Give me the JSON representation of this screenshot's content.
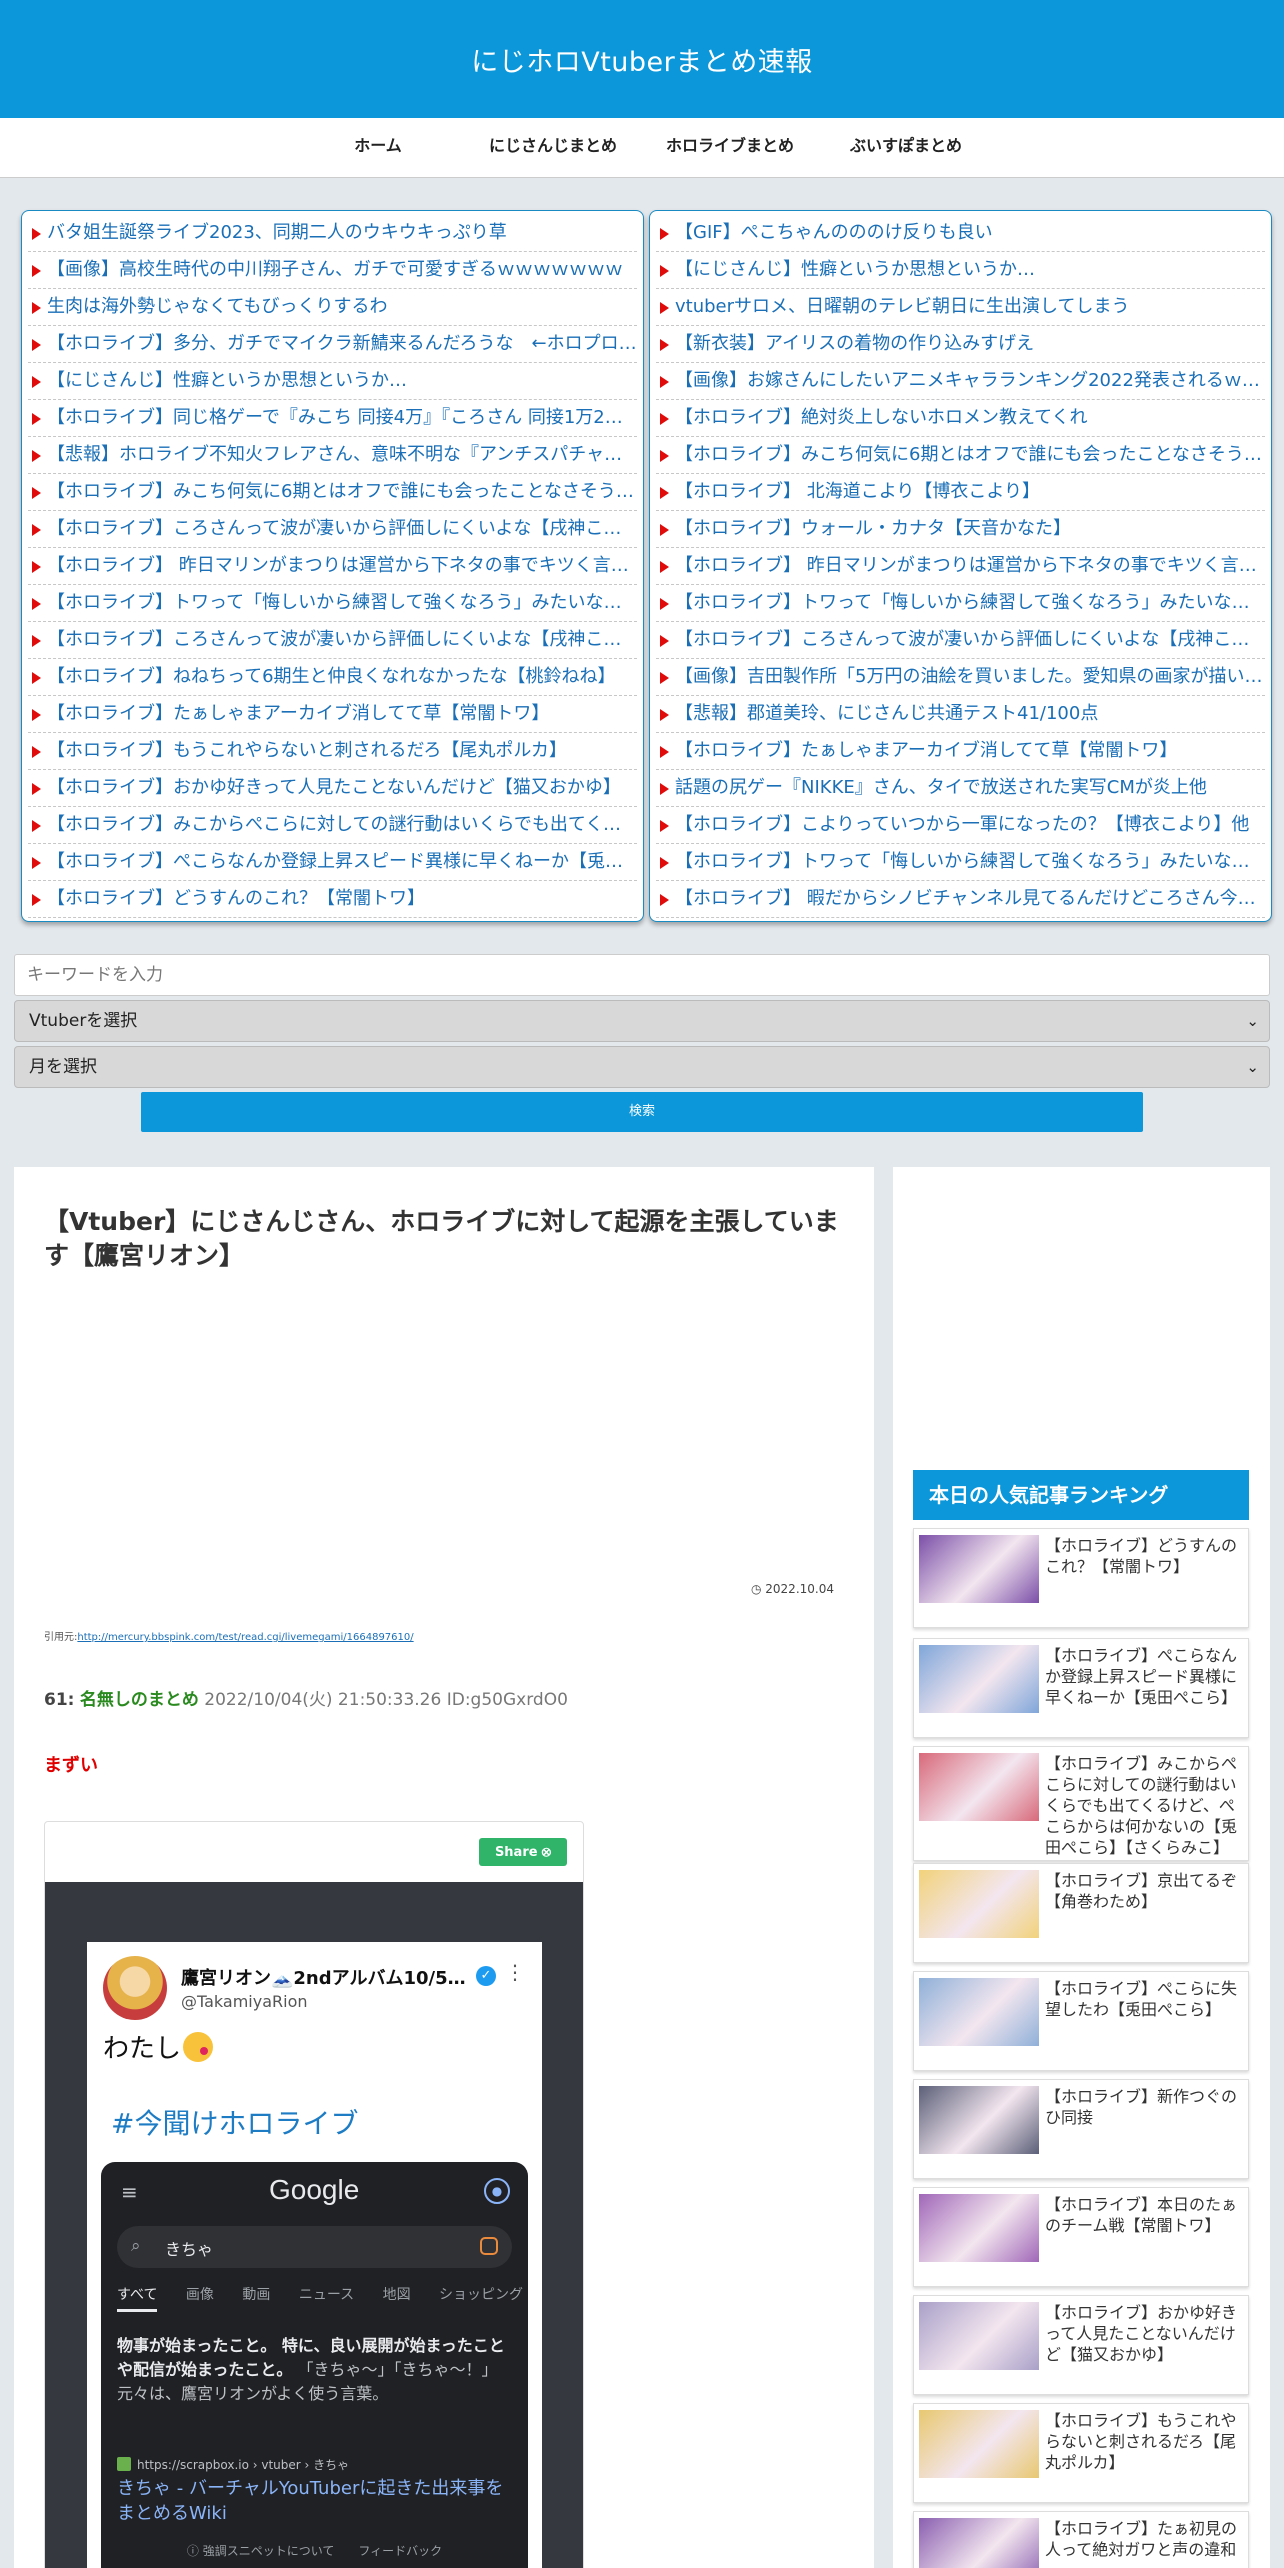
{
  "site": {
    "title": "にじホロVtuberまとめ速報"
  },
  "nav": [
    "ホーム",
    "にじさんじまとめ",
    "ホロライブまとめ",
    "ぶいすぽまとめ"
  ],
  "links_left": [
    "バタ姐生誕祭ライブ2023、同期二人のウキウキっぷり草",
    "【画像】高校生時代の中川翔子さん、ガチで可愛すぎるｗｗｗｗｗｗｗ",
    "生肉は海外勢じゃなくてもびっくりするわ",
    "【ホロライブ】多分、ガチでマイクラ新鯖来るんだろうな　←ホロプロ…",
    "【にじさんじ】性癖というか思想というか…",
    "【ホロライブ】同じ格ゲーで『みこち 同接4万』『ころさん 同接1万2…",
    "【悲報】ホロライブ不知火フレアさん、意味不明な『アンチスパチャ』…",
    "【ホロライブ】みこち何気に6期とはオフで誰にも会ったことなさそう…",
    "【ホロライブ】ころさんって波が凄いから評価しにくいよな【戌神ころ…",
    "【ホロライブ】 昨日マリンがまつりは運営から下ネタの事でキツく言…",
    "【ホロライブ】トワって「悔しいから練習して強くなろう」みたいな感…",
    "【ホロライブ】ころさんって波が凄いから評価しにくいよな【戌神ころ…",
    "【ホロライブ】ねねちって6期生と仲良くなれなかったな【桃鈴ねね】",
    "【ホロライブ】たぁしゃまアーカイブ消してて草【常闇トワ】",
    "【ホロライブ】もうこれやらないと刺されるだろ【尾丸ポルカ】",
    "【ホロライブ】おかゆ好きって人見たことないんだけど【猫又おかゆ】",
    "【ホロライブ】みこからぺこらに対しての謎行動はいくらでも出てくる…",
    "【ホロライブ】ぺこらなんか登録上昇スピード異様に早くねーか【兎田…",
    "【ホロライブ】どうすんのこれ？【常闇トワ】"
  ],
  "links_right": [
    "【GIF】ぺこちゃんのののけ反りも良い",
    "【にじさんじ】性癖というか思想というか…",
    "vtuberサロメ、日曜朝のテレビ朝日に生出演してしまう",
    "【新衣装】アイリスの着物の作り込みすげえ",
    "【画像】お嫁さんにしたいアニメキャラランキング2022発表されるｗ…",
    "【ホロライブ】絶対炎上しないホロメン教えてくれ",
    "【ホロライブ】みこち何気に6期とはオフで誰にも会ったことなさそう…",
    "【ホロライブ】 北海道こより【博衣こより】",
    "【ホロライブ】ウォール・カナタ【天音かなた】",
    "【ホロライブ】 昨日マリンがまつりは運営から下ネタの事でキツく言…",
    "【ホロライブ】トワって「悔しいから練習して強くなろう」みたいな感…",
    "【ホロライブ】ころさんって波が凄いから評価しにくいよな【戌神ころ…",
    "【画像】吉田製作所「5万円の油絵を買いました。愛知県の画家が描い…",
    "【悲報】郡道美玲、にじさんじ共通テスト41/100点",
    "【ホロライブ】たぁしゃまアーカイブ消してて草【常闇トワ】",
    "話題の尻ゲー『NIKKE』さん、タイで放送された実写CMが炎上他",
    "【ホロライブ】こよりっていつから一軍になったの？【博衣こより】他",
    "【ホロライブ】トワって「悔しいから練習して強くなろう」みたいな感…",
    "【ホロライブ】 暇だからシノビチャンネル見てるんだけどころさん今…"
  ],
  "search": {
    "placeholder": "キーワードを入力",
    "vtuber_select": "Vtuberを選択",
    "month_select": "月を選択",
    "button": "検索"
  },
  "article": {
    "title": "【Vtuber】にじさんじさん、ホロライブに対して起源を主張しています【鷹宮リオン】",
    "date": "2022.10.04",
    "source_label": "引用元:",
    "source_url": "http://mercury.bbspink.com/test/read.cgi/livemegami/1664897610/",
    "res_number": "61:",
    "res_name": "名無しのまとめ",
    "res_meta": "2022/10/04(火) 21:50:33.26 ID:g50GxrdO0",
    "res_body": "まずい"
  },
  "tweet": {
    "share_label": "Share",
    "name": "鷹宮リオン🗻2ndアルバム10/5…",
    "handle": "@TakamiyaRion",
    "text": "わたし",
    "hashtag": "#今聞けホロライブ",
    "google": {
      "logo": "Google",
      "query": "きちゃ",
      "tabs": [
        "すべて",
        "画像",
        "動画",
        "ニュース",
        "地図",
        "ショッピング"
      ],
      "snippet_bold": "物事が始まったこと。 特に、良い展開が始まったことや配信が始まったこと。",
      "snippet_rest": "「きちゃ〜」「きちゃ〜！」 元々は、鷹宮リオンがよく使う言葉。",
      "url": "https://scrapbox.io › vtuber › きちゃ",
      "result_title": "きちゃ - バーチャルYouTuberに起きた出来事をまとめるWiki",
      "footer": "強調スニペットについて　　フィードバック"
    }
  },
  "sidebar": {
    "ranking_title": "本日の人気記事ランキング",
    "items": [
      {
        "title": "【ホロライブ】どうすんのこれ？【常闇トワ】",
        "thumb_color": "#7b4fa8"
      },
      {
        "title": "【ホロライブ】ぺこらなんか登録上昇スピード異様に早くねーか【兎田ぺこら】",
        "thumb_color": "#7fa6d9"
      },
      {
        "title": "【ホロライブ】みこからぺこらに対しての謎行動はいくらでも出てくるけど、ぺこらからは何かないの【兎田ぺこら】【さくらみこ】",
        "thumb_color": "#d8697a"
      },
      {
        "title": "【ホロライブ】京出てるぞ【角巻わため】",
        "thumb_color": "#f2d27a"
      },
      {
        "title": "【ホロライブ】ぺこらに失望したわ【兎田ぺこら】",
        "thumb_color": "#8fb0d8"
      },
      {
        "title": "【ホロライブ】新作つぐのひ同接",
        "thumb_color": "#5b5f78"
      },
      {
        "title": "【ホロライブ】本日のたぁのチーム戦【常闇トワ】",
        "thumb_color": "#a067b8"
      },
      {
        "title": "【ホロライブ】おかゆ好きって人見たことないんだけど【猫又おかゆ】",
        "thumb_color": "#a9a0c8"
      },
      {
        "title": "【ホロライブ】もうこれやらないと刺されるだろ【尾丸ポルカ】",
        "thumb_color": "#e8c870"
      },
      {
        "title": "【ホロライブ】たぁ初見の人って絶対ガワと声の違和",
        "thumb_color": "#8a5fb0"
      }
    ]
  }
}
